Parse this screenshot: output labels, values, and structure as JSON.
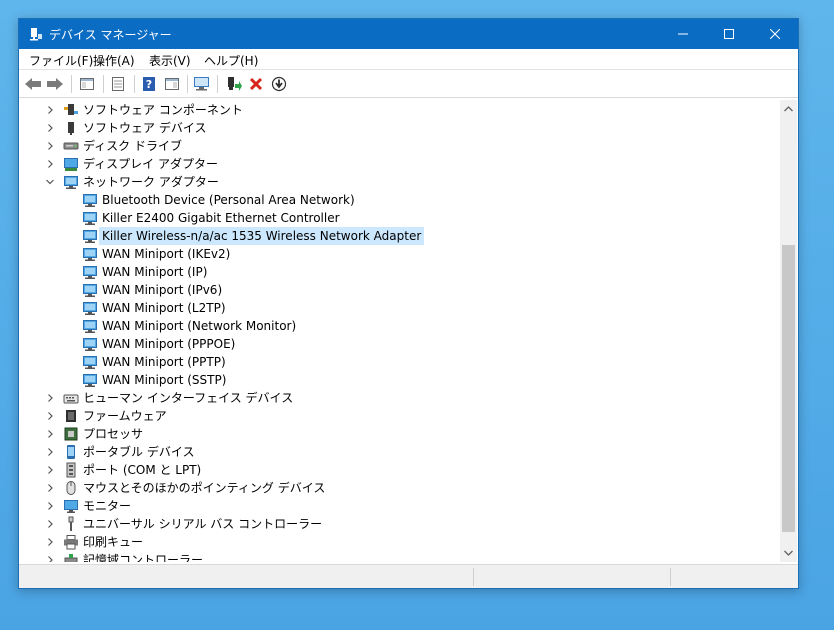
{
  "window": {
    "title": "デバイス マネージャー"
  },
  "menu": [
    {
      "label": "ファイル(F)"
    },
    {
      "label": "操作(A)"
    },
    {
      "label": "表示(V)"
    },
    {
      "label": "ヘルプ(H)"
    }
  ],
  "toolbar": {
    "buttons": [
      {
        "name": "back-icon"
      },
      {
        "name": "forward-icon"
      },
      {
        "name": "show-hide-console-tree-icon"
      },
      {
        "name": "properties-icon"
      },
      {
        "name": "help-icon"
      },
      {
        "name": "action-pane-icon"
      },
      {
        "name": "scan-hardware-icon"
      },
      {
        "name": "update-driver-icon"
      },
      {
        "name": "uninstall-icon"
      },
      {
        "name": "disable-device-icon"
      }
    ]
  },
  "tree": {
    "rows": [
      {
        "label": "ソフトウェア コンポーネント",
        "level": 0,
        "expand": "collapsed",
        "icon": "software-component-icon"
      },
      {
        "label": "ソフトウェア デバイス",
        "level": 0,
        "expand": "collapsed",
        "icon": "software-device-icon"
      },
      {
        "label": "ディスク ドライブ",
        "level": 0,
        "expand": "collapsed",
        "icon": "disk-drive-icon"
      },
      {
        "label": "ディスプレイ アダプター",
        "level": 0,
        "expand": "collapsed",
        "icon": "display-adapter-icon"
      },
      {
        "label": "ネットワーク アダプター",
        "level": 0,
        "expand": "expanded",
        "icon": "network-adapter-icon"
      },
      {
        "label": "Bluetooth Device (Personal Area Network)",
        "level": 1,
        "expand": "none",
        "icon": "network-adapter-icon"
      },
      {
        "label": "Killer E2400 Gigabit Ethernet Controller",
        "level": 1,
        "expand": "none",
        "icon": "network-adapter-icon"
      },
      {
        "label": "Killer Wireless-n/a/ac 1535 Wireless Network Adapter",
        "level": 1,
        "expand": "none",
        "icon": "network-adapter-icon",
        "selected": true
      },
      {
        "label": "WAN Miniport (IKEv2)",
        "level": 1,
        "expand": "none",
        "icon": "network-adapter-icon"
      },
      {
        "label": "WAN Miniport (IP)",
        "level": 1,
        "expand": "none",
        "icon": "network-adapter-icon"
      },
      {
        "label": "WAN Miniport (IPv6)",
        "level": 1,
        "expand": "none",
        "icon": "network-adapter-icon"
      },
      {
        "label": "WAN Miniport (L2TP)",
        "level": 1,
        "expand": "none",
        "icon": "network-adapter-icon"
      },
      {
        "label": "WAN Miniport (Network Monitor)",
        "level": 1,
        "expand": "none",
        "icon": "network-adapter-icon"
      },
      {
        "label": "WAN Miniport (PPPOE)",
        "level": 1,
        "expand": "none",
        "icon": "network-adapter-icon"
      },
      {
        "label": "WAN Miniport (PPTP)",
        "level": 1,
        "expand": "none",
        "icon": "network-adapter-icon"
      },
      {
        "label": "WAN Miniport (SSTP)",
        "level": 1,
        "expand": "none",
        "icon": "network-adapter-icon"
      },
      {
        "label": "ヒューマン インターフェイス デバイス",
        "level": 0,
        "expand": "collapsed",
        "icon": "hid-icon"
      },
      {
        "label": "ファームウェア",
        "level": 0,
        "expand": "collapsed",
        "icon": "firmware-icon"
      },
      {
        "label": "プロセッサ",
        "level": 0,
        "expand": "collapsed",
        "icon": "processor-icon"
      },
      {
        "label": "ポータブル デバイス",
        "level": 0,
        "expand": "collapsed",
        "icon": "portable-device-icon"
      },
      {
        "label": "ポート (COM と LPT)",
        "level": 0,
        "expand": "collapsed",
        "icon": "port-icon"
      },
      {
        "label": "マウスとそのほかのポインティング デバイス",
        "level": 0,
        "expand": "collapsed",
        "icon": "mouse-icon"
      },
      {
        "label": "モニター",
        "level": 0,
        "expand": "collapsed",
        "icon": "monitor-icon"
      },
      {
        "label": "ユニバーサル シリアル バス コントローラー",
        "level": 0,
        "expand": "collapsed",
        "icon": "usb-icon"
      },
      {
        "label": "印刷キュー",
        "level": 0,
        "expand": "collapsed",
        "icon": "printer-icon"
      },
      {
        "label": "記憶域コントローラー",
        "level": 0,
        "expand": "collapsed",
        "icon": "storage-controller-icon"
      }
    ]
  },
  "colors": {
    "titlebar": "#0b6cc4",
    "selection": "#cce8ff"
  }
}
